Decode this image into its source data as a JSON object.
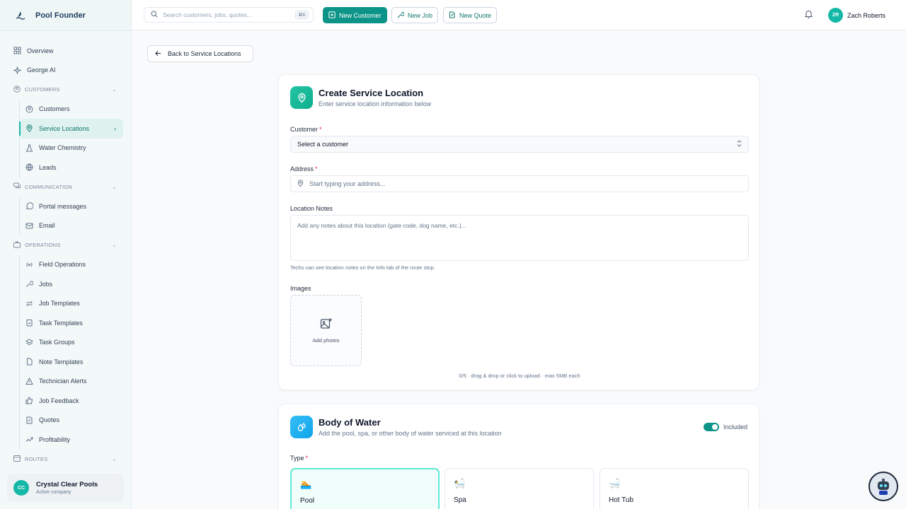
{
  "brand": {
    "name": "Pool Founder"
  },
  "sidebar": {
    "top_items": [
      {
        "label": "Overview",
        "icon": "grid-icon"
      },
      {
        "label": "George AI",
        "icon": "sparkle-icon"
      }
    ],
    "sections": {
      "customers": {
        "title": "CUSTOMERS",
        "items": [
          "Customers",
          "Service Locations",
          "Water Chemistry",
          "Leads"
        ]
      },
      "communication": {
        "title": "COMMUNICATION",
        "items": [
          "Portal messages",
          "Email"
        ]
      },
      "operations": {
        "title": "OPERATIONS",
        "items": [
          "Field Operations",
          "Jobs",
          "Job Templates",
          "Task Templates",
          "Task Groups",
          "Note Templates",
          "Technician Alerts",
          "Job Feedback",
          "Quotes",
          "Profitability"
        ]
      },
      "routes": {
        "title": "ROUTES"
      }
    },
    "active_item": "Service Locations",
    "company": {
      "initials": "CC",
      "name": "Crystal Clear Pools",
      "status": "Active company"
    }
  },
  "topbar": {
    "search_placeholder": "Search customers, jobs, quotes...",
    "search_shortcut": "⌘K",
    "new_customer": "New Customer",
    "new_job": "New Job",
    "new_quote": "New Quote",
    "user": {
      "initials": "ZR",
      "name": "Zach Roberts"
    }
  },
  "back_button": "Back to Service Locations",
  "location_card": {
    "title": "Create Service Location",
    "subtitle": "Enter service location information below",
    "customer_label": "Customer",
    "customer_value": "Select a customer",
    "address_label": "Address",
    "address_placeholder": "Start typing your address...",
    "notes_label": "Location Notes",
    "notes_placeholder": "Add any notes about this location (gate code, dog name, etc.)...",
    "notes_hint": "Techs can see location notes on the Info tab of the route stop.",
    "images_label": "Images",
    "add_photos": "Add photos",
    "upload_hint": "0/5 · drag & drop or click to upload · max 5MB each",
    "required_mark": "*"
  },
  "water_card": {
    "title": "Body of Water",
    "subtitle": "Add the pool, spa, or other body of water serviced at this location",
    "toggle_label": "Included",
    "toggle_on": true,
    "type_label": "Type",
    "types": [
      {
        "name": "Pool",
        "emoji": "🏊",
        "selected": true
      },
      {
        "name": "Spa",
        "emoji": "🛀",
        "selected": false
      },
      {
        "name": "Hot Tub",
        "emoji": "🛁",
        "selected": false
      }
    ]
  },
  "colors": {
    "accent": "#0d9488",
    "accent_light": "#14b8a6",
    "active_bg": "#dff2f0",
    "required": "#e11d48"
  }
}
